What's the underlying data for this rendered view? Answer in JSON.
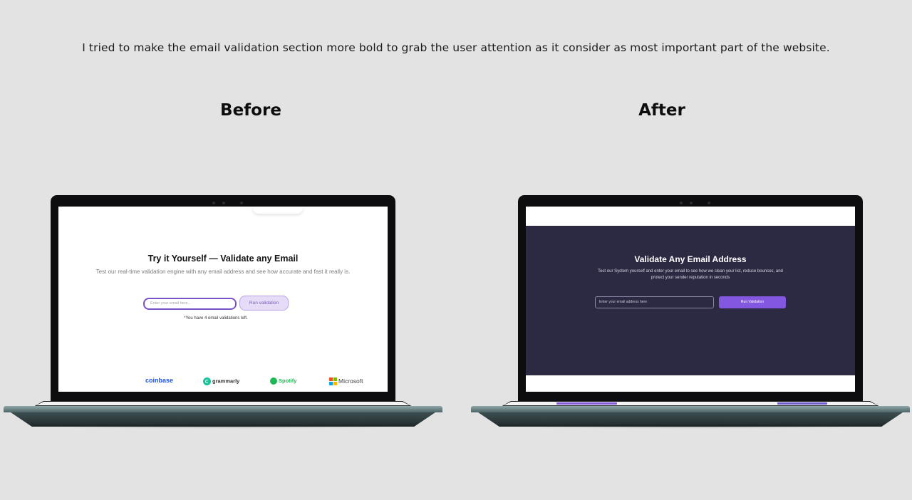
{
  "intro_text": "I tried to make the email validation section more bold to grab the user attention as it consider as most important part of the website.",
  "before": {
    "heading": "Before",
    "title": "Try it Yourself — Validate any Email",
    "subtitle": "Test our real-time validation engine with any email address and see how accurate and fast it really is.",
    "input_placeholder": "Enter your email here...",
    "button_label": "Run validation",
    "note": "*You have 4 email validations left.",
    "logos": [
      "coinbase",
      "grammarly",
      "Spotify",
      "Microsoft"
    ],
    "colors": {
      "accent": "#7b52c8",
      "button_bg": "#e6dcf7"
    }
  },
  "after": {
    "heading": "After",
    "title": "Validate Any Email Address",
    "subtitle": "Test our System yourself and enter your email to see how we clean your list, reduce bounces, and protect your sender reputation in seconds",
    "input_placeholder": "Enter your email address here",
    "button_label": "Run Validation",
    "colors": {
      "panel_bg": "#2c2942",
      "button_bg": "#8457e0"
    }
  },
  "colors": {
    "page_bg": "#e3e3e3",
    "laptop_base": "#4d6466"
  }
}
